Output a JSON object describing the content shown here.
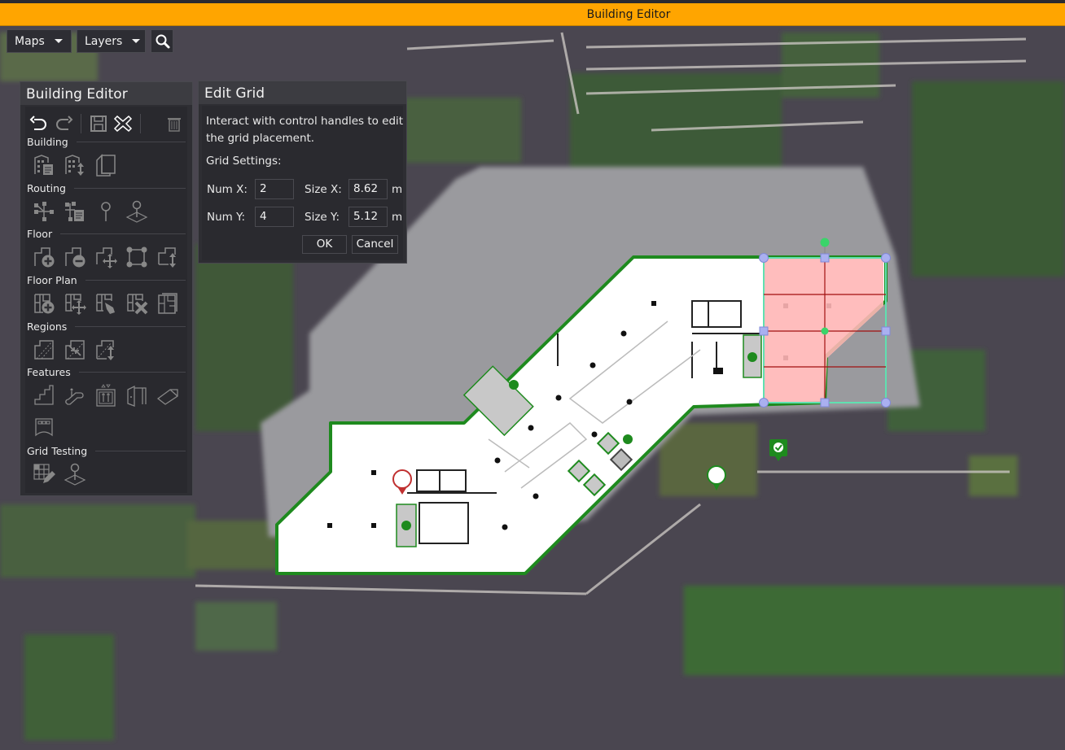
{
  "window": {
    "title": "Building Editor",
    "accent": "#ffa500"
  },
  "top_toolbar": {
    "maps_label": "Maps",
    "layers_label": "Layers",
    "search_icon": "search-icon"
  },
  "editor_panel": {
    "title": "Building Editor",
    "actions": [
      "undo-icon",
      "redo-icon",
      "save-icon",
      "close-x-icon",
      "trash-icon"
    ],
    "sections": [
      {
        "label": "Building",
        "icons": [
          "building-properties-icon",
          "building-move-level-icon",
          "building-copy-icon"
        ]
      },
      {
        "label": "Routing",
        "icons": [
          "routing-network-icon",
          "routing-properties-icon",
          "routing-pin-icon",
          "routing-pin-floor-icon"
        ]
      },
      {
        "label": "Floor",
        "icons": [
          "floor-add-icon",
          "floor-remove-icon",
          "floor-move-icon",
          "floor-vertices-icon",
          "floor-change-level-icon"
        ]
      },
      {
        "label": "Floor Plan",
        "icons": [
          "floorplan-add-icon",
          "floorplan-move-icon",
          "floorplan-pin-icon",
          "floorplan-delete-icon",
          "floorplan-stack-icon"
        ]
      },
      {
        "label": "Regions",
        "icons": [
          "region-split-icon",
          "region-merge-icon",
          "region-level-icon"
        ]
      },
      {
        "label": "Features",
        "icons": [
          "stairs-icon",
          "escalator-icon",
          "elevator-icon",
          "door-icon",
          "ramp-icon",
          "kiosk-icon"
        ]
      },
      {
        "label": "Grid Testing",
        "icons": [
          "grid-edit-icon",
          "grid-pin-icon"
        ]
      }
    ]
  },
  "edit_grid_dialog": {
    "title": "Edit Grid",
    "instructions": "Interact with control handles to edit the grid placement.",
    "settings_label": "Grid Settings:",
    "num_x_label": "Num X:",
    "num_x_value": "2",
    "num_y_label": "Num Y:",
    "num_y_value": "4",
    "size_x_label": "Size X:",
    "size_x_value": "8.62",
    "size_y_label": "Size Y:",
    "size_y_value": "5.12",
    "unit": "m",
    "ok_label": "OK",
    "cancel_label": "Cancel"
  },
  "map": {
    "outline_color": "#1e8a1e",
    "grid_fill": "#ffb6b6",
    "grid_line": "#a01010",
    "handle_color": "#aab0f0",
    "rotate_handle_color": "#3ad46a"
  }
}
